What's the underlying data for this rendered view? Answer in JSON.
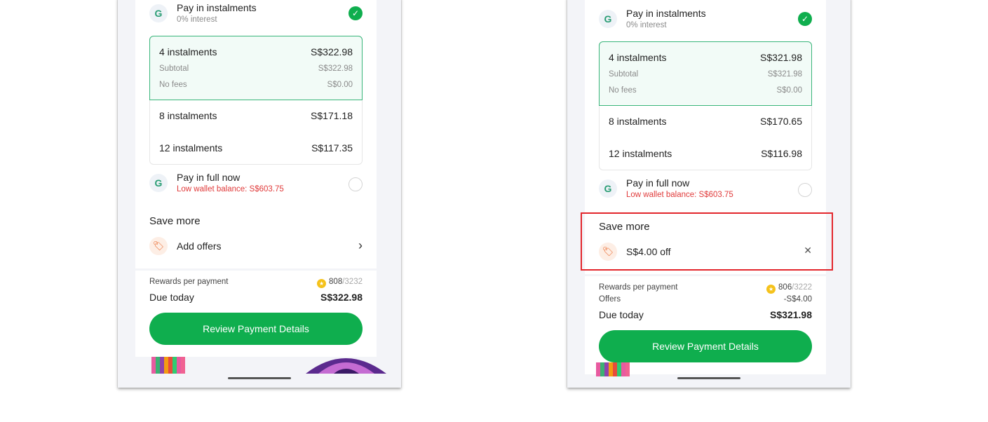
{
  "left": {
    "option_pay_instalments": {
      "title": "Pay in instalments",
      "sub": "0% interest",
      "icon": "G"
    },
    "plans": {
      "selected": {
        "label": "4 instalments",
        "amount": "S$322.98",
        "subtotal_label": "Subtotal",
        "subtotal": "S$322.98",
        "fees_label": "No fees",
        "fees": "S$0.00"
      },
      "p8": {
        "label": "8 instalments",
        "amount": "S$171.18"
      },
      "p12": {
        "label": "12 instalments",
        "amount": "S$117.35"
      }
    },
    "option_pay_full": {
      "title": "Pay in full now",
      "sub": "Low wallet balance: S$603.75",
      "icon": "G"
    },
    "save_more": {
      "title": "Save more",
      "offer_label": "Add offers"
    },
    "summary": {
      "rewards_label": "Rewards per payment",
      "rewards_value": "808",
      "rewards_total": "/3232",
      "due_label": "Due today",
      "due_value": "S$322.98"
    },
    "cta": "Review Payment Details"
  },
  "right": {
    "option_pay_instalments": {
      "title": "Pay in instalments",
      "sub": "0% interest",
      "icon": "G"
    },
    "plans": {
      "selected": {
        "label": "4 instalments",
        "amount": "S$321.98",
        "subtotal_label": "Subtotal",
        "subtotal": "S$321.98",
        "fees_label": "No fees",
        "fees": "S$0.00"
      },
      "p8": {
        "label": "8 instalments",
        "amount": "S$170.65"
      },
      "p12": {
        "label": "12 instalments",
        "amount": "S$116.98"
      }
    },
    "option_pay_full": {
      "title": "Pay in full now",
      "sub": "Low wallet balance: S$603.75",
      "icon": "G"
    },
    "save_more": {
      "title": "Save more",
      "offer_label": "S$4.00 off"
    },
    "summary": {
      "rewards_label": "Rewards per payment",
      "rewards_value": "806",
      "rewards_total": "/3222",
      "offers_label": "Offers",
      "offers_value": "-S$4.00",
      "due_label": "Due today",
      "due_value": "S$321.98"
    },
    "cta": "Review Payment Details"
  },
  "icons": {
    "check": "✓",
    "chevron": "›",
    "close": "✕",
    "tag": "🏷",
    "coin": "★"
  },
  "colors": {
    "primary": "#0fae4e",
    "selected_border": "#39b57a",
    "warning": "#e03a3a",
    "highlight": "#e3262c"
  }
}
